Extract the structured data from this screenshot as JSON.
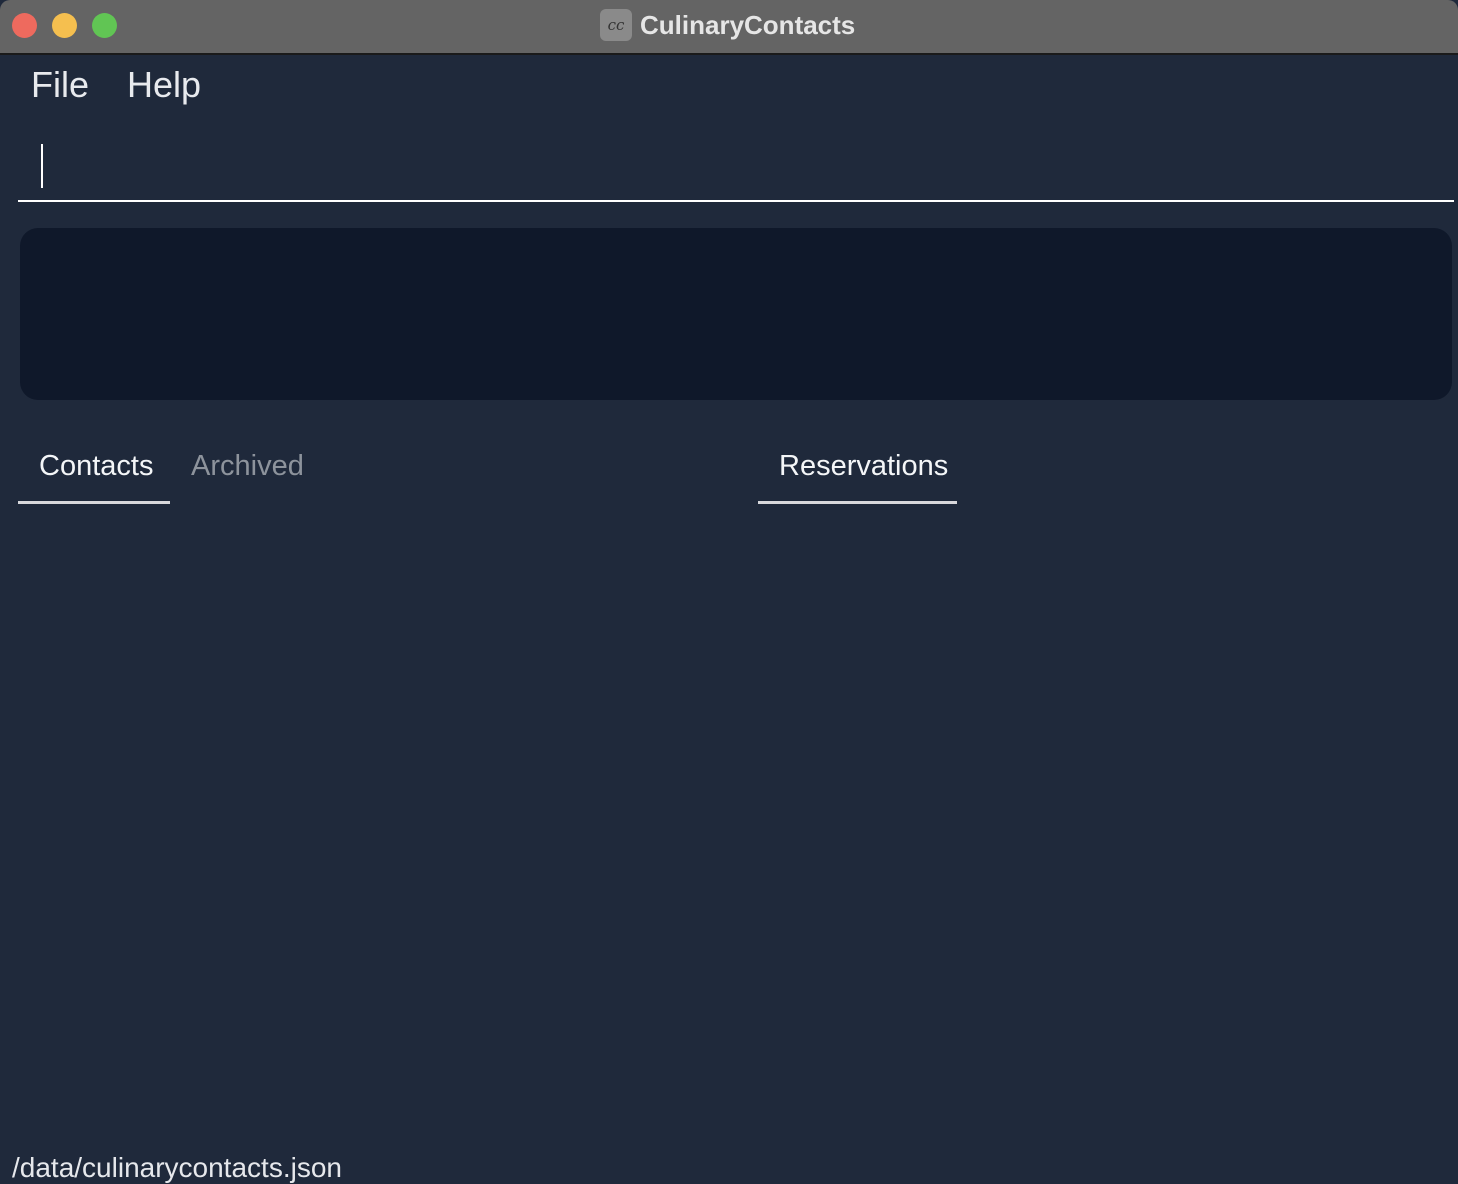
{
  "window": {
    "title": "CulinaryContacts",
    "app_icon": "cc-logo-icon",
    "app_icon_glyph": "cc"
  },
  "menu": {
    "items": [
      {
        "label": "File"
      },
      {
        "label": "Help"
      }
    ]
  },
  "command_box": {
    "value": "",
    "placeholder": ""
  },
  "result_display": {
    "text": ""
  },
  "tabs": {
    "left": [
      {
        "label": "Contacts",
        "active": true
      },
      {
        "label": "Archived",
        "active": false
      }
    ],
    "right": [
      {
        "label": "Reservations",
        "active": true
      }
    ]
  },
  "contacts_list": [],
  "reservations_list": [],
  "status_bar": {
    "path": "/data/culinarycontacts.json"
  },
  "colors": {
    "background": "#1f293b",
    "result_background": "#0f182a",
    "titlebar": "#646464",
    "close": "#ee6a5e",
    "minimize": "#f5bf4f",
    "maximize": "#61c554"
  }
}
